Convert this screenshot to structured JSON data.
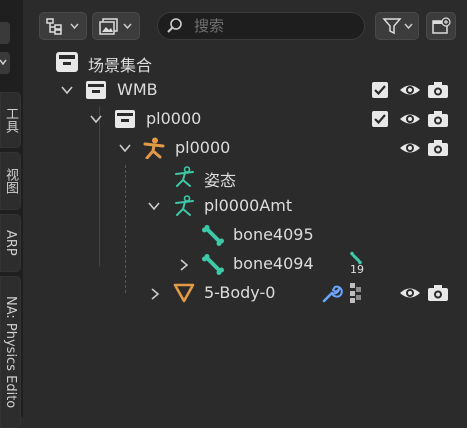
{
  "sidebar": {
    "tabs": [
      "工具",
      "视图",
      "ARP",
      "NA: Physics Edito"
    ]
  },
  "header": {
    "search_placeholder": "搜索"
  },
  "tree": {
    "scene_collection": "场景集合",
    "wmb": "WMB",
    "pl_collection": "pl0000",
    "pl_armature_obj": "pl0000",
    "pose": "姿态",
    "armature_data": "pl0000Amt",
    "bone1": "bone4095",
    "bone2": "bone4094",
    "bone_count": "19",
    "mesh": "5-Body-0"
  },
  "colors": {
    "background": "#2b2b2b",
    "armature_orange": "#e39a47",
    "bone_teal": "#3fc8a6",
    "modifier_blue": "#6aa6ff"
  }
}
